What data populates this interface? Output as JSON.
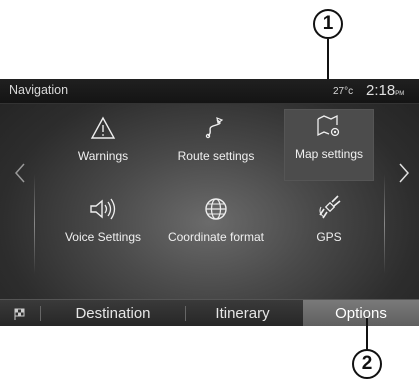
{
  "callouts": {
    "one": "1",
    "two": "2"
  },
  "header": {
    "title": "Navigation",
    "temperature": "27°c",
    "time": "2:18",
    "ampm": "PM"
  },
  "tiles": [
    {
      "label": "Warnings",
      "icon": "warning-icon"
    },
    {
      "label": "Route settings",
      "icon": "route-icon"
    },
    {
      "label": "Map settings",
      "icon": "map-settings-icon"
    },
    {
      "label": "Voice Settings",
      "icon": "speaker-icon"
    },
    {
      "label": "Coordinate format",
      "icon": "globe-icon"
    },
    {
      "label": "GPS",
      "icon": "satellite-icon"
    }
  ],
  "tabs": {
    "flag_icon": "flag-icon",
    "items": [
      {
        "label": "Destination"
      },
      {
        "label": "Itinerary"
      },
      {
        "label": "Options"
      }
    ]
  },
  "colors": {
    "screen_bg": "#2d2d2d",
    "active_tile": "#4c4c4c",
    "active_tab": "#6e6e6e"
  }
}
